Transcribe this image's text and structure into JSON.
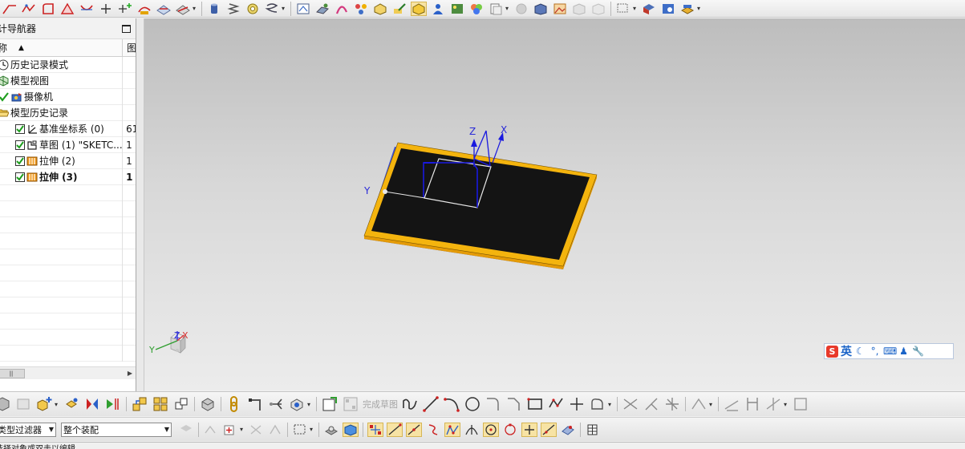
{
  "navigator": {
    "title": "计导航器",
    "col_name": "称",
    "col_val": "图",
    "rows": [
      {
        "label": "历史记录模式",
        "value": "",
        "icon": "clock-icon",
        "bold": false
      },
      {
        "label": "模型视图",
        "value": "",
        "icon": "model-views-icon",
        "bold": false
      },
      {
        "label": "摄像机",
        "value": "",
        "icon": "camera-icon",
        "bold": false
      },
      {
        "label": "模型历史记录",
        "value": "",
        "icon": "folder-open-icon",
        "bold": false
      },
      {
        "label": "基准坐标系 (0)",
        "value": "61",
        "icon": "datum-csys-icon",
        "bold": false,
        "checked": true
      },
      {
        "label": "草图 (1) \"SKETC...",
        "value": "1",
        "icon": "sketch-icon",
        "bold": false,
        "checked": true
      },
      {
        "label": "拉伸 (2)",
        "value": "1",
        "icon": "extrude-icon",
        "bold": false,
        "checked": true
      },
      {
        "label": "拉伸 (3)",
        "value": "1",
        "icon": "extrude-icon",
        "bold": true,
        "checked": true
      }
    ]
  },
  "viewport": {
    "axis_labels": {
      "z": "Z",
      "x": "X",
      "y": "Y"
    },
    "triad_labels": {
      "z": "Z",
      "x": "X",
      "y": "Y"
    },
    "colors": {
      "plate_top": "#141414",
      "plate_edge": "#f4b40e",
      "plate_side": "#e49b08",
      "sketch": "#1a1adf",
      "background_top": "#bdbdbd",
      "background_bottom": "#ececec"
    }
  },
  "ime": {
    "lang_label": "英",
    "logo_label": "S"
  },
  "sketch_toolbar": {
    "finish_sketch_label": "完成草图"
  },
  "filters": {
    "type_filter": "类型过滤器",
    "scope": "整个装配"
  },
  "status": {
    "text": "选择对象或双击以编辑"
  }
}
